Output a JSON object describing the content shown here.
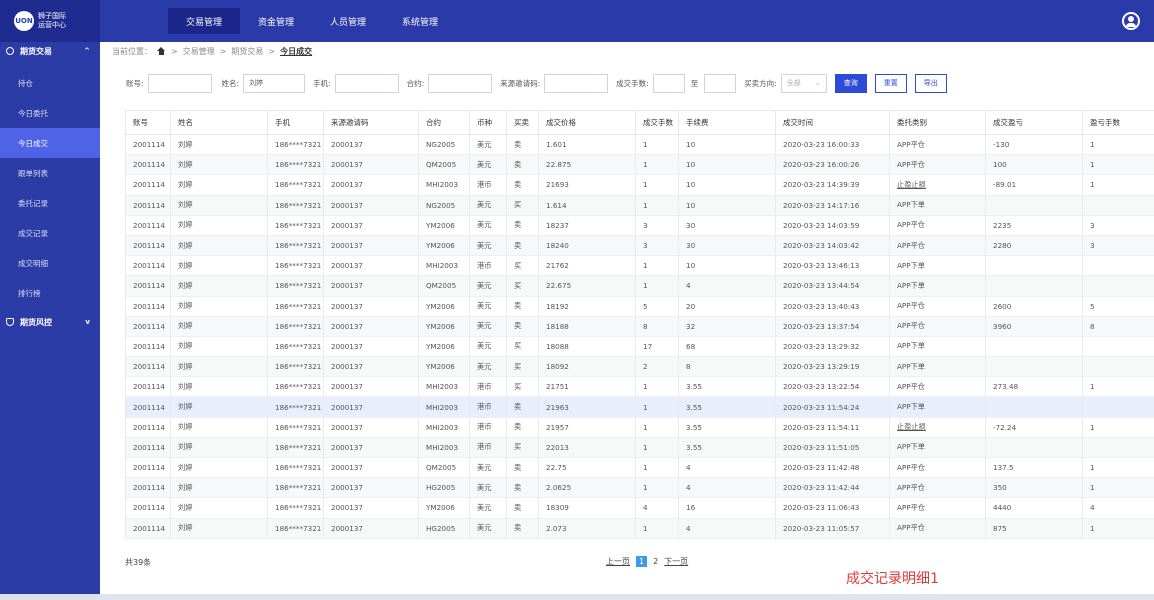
{
  "logo": {
    "mark": "UON",
    "line1": "狮子国际",
    "line2": "运营中心"
  },
  "top_nav": [
    {
      "label": "交易管理",
      "active": true
    },
    {
      "label": "资金管理",
      "active": false
    },
    {
      "label": "人员管理",
      "active": false
    },
    {
      "label": "系统管理",
      "active": false
    }
  ],
  "sidebar": {
    "group1": {
      "label": "期货交易",
      "chevron": "^"
    },
    "items": [
      {
        "label": "持仓",
        "active": false
      },
      {
        "label": "今日委托",
        "active": false
      },
      {
        "label": "今日成交",
        "active": true
      },
      {
        "label": "跟单列表",
        "active": false
      },
      {
        "label": "委托记录",
        "active": false
      },
      {
        "label": "成交记录",
        "active": false
      },
      {
        "label": "成交明细",
        "active": false
      },
      {
        "label": "排行榜",
        "active": false
      }
    ],
    "group2": {
      "label": "期货风控",
      "chevron": "v"
    }
  },
  "breadcrumb": {
    "prefix": "当前位置：",
    "items": [
      "交易管理",
      "期货交易"
    ],
    "current": "今日成交",
    "sep": ">"
  },
  "filters": {
    "account_label": "账号:",
    "name_label": "姓名:",
    "name_value": "刘婷",
    "phone_label": "手机:",
    "contract_label": "合约:",
    "invite_label": "来源邀请码:",
    "lots_label": "成交手数:",
    "to_label": "至",
    "direction_label": "买卖方向:",
    "direction_value": "全部",
    "query_button": "查询",
    "reset_button": "重置",
    "export_button": "导出"
  },
  "table": {
    "columns": [
      "账号",
      "姓名",
      "手机",
      "来源邀请码",
      "合约",
      "币种",
      "买卖",
      "成交价格",
      "成交手数",
      "手续费",
      "成交时间",
      "委托类别",
      "成交盈亏",
      "盈亏手数"
    ],
    "rows": [
      [
        "2001114",
        "刘婷",
        "186****7321",
        "2000137",
        "NG2005",
        "美元",
        "卖",
        "1.601",
        "1",
        "10",
        "2020-03-23 16:00:33",
        "APP平仓",
        "-130",
        "1"
      ],
      [
        "2001114",
        "刘婷",
        "186****7321",
        "2000137",
        "QM2005",
        "美元",
        "卖",
        "22.875",
        "1",
        "10",
        "2020-03-23 16:00:26",
        "APP平仓",
        "100",
        "1"
      ],
      [
        "2001114",
        "刘婷",
        "186****7321",
        "2000137",
        "MHI2003",
        "港币",
        "卖",
        "21693",
        "1",
        "10",
        "2020-03-23 14:39:39",
        "止盈止损",
        "-89.01",
        "1"
      ],
      [
        "2001114",
        "刘婷",
        "186****7321",
        "2000137",
        "NG2005",
        "美元",
        "买",
        "1.614",
        "1",
        "10",
        "2020-03-23 14:17:16",
        "APP下单",
        "",
        ""
      ],
      [
        "2001114",
        "刘婷",
        "186****7321",
        "2000137",
        "YM2006",
        "美元",
        "卖",
        "18237",
        "3",
        "30",
        "2020-03-23 14:03:59",
        "APP平仓",
        "2235",
        "3"
      ],
      [
        "2001114",
        "刘婷",
        "186****7321",
        "2000137",
        "YM2006",
        "美元",
        "卖",
        "18240",
        "3",
        "30",
        "2020-03-23 14:03:42",
        "APP平仓",
        "2280",
        "3"
      ],
      [
        "2001114",
        "刘婷",
        "186****7321",
        "2000137",
        "MHI2003",
        "港币",
        "买",
        "21762",
        "1",
        "10",
        "2020-03-23 13:46:13",
        "APP下单",
        "",
        ""
      ],
      [
        "2001114",
        "刘婷",
        "186****7321",
        "2000137",
        "QM2005",
        "美元",
        "买",
        "22.675",
        "1",
        "4",
        "2020-03-23 13:44:54",
        "APP下单",
        "",
        ""
      ],
      [
        "2001114",
        "刘婷",
        "186****7321",
        "2000137",
        "YM2006",
        "美元",
        "卖",
        "18192",
        "5",
        "20",
        "2020-03-23 13:40:43",
        "APP平仓",
        "2600",
        "5"
      ],
      [
        "2001114",
        "刘婷",
        "186****7321",
        "2000137",
        "YM2006",
        "美元",
        "卖",
        "18188",
        "8",
        "32",
        "2020-03-23 13:37:54",
        "APP平仓",
        "3960",
        "8"
      ],
      [
        "2001114",
        "刘婷",
        "186****7321",
        "2000137",
        "YM2006",
        "美元",
        "买",
        "18088",
        "17",
        "68",
        "2020-03-23 13:29:32",
        "APP下单",
        "",
        ""
      ],
      [
        "2001114",
        "刘婷",
        "186****7321",
        "2000137",
        "YM2006",
        "美元",
        "买",
        "18092",
        "2",
        "8",
        "2020-03-23 13:29:19",
        "APP下单",
        "",
        ""
      ],
      [
        "2001114",
        "刘婷",
        "186****7321",
        "2000137",
        "MHI2003",
        "港币",
        "买",
        "21751",
        "1",
        "3.55",
        "2020-03-23 13:22:54",
        "APP平仓",
        "273.48",
        "1"
      ],
      [
        "2001114",
        "刘婷",
        "186****7321",
        "2000137",
        "MHI2003",
        "港币",
        "卖",
        "21963",
        "1",
        "3.55",
        "2020-03-23 11:54:24",
        "APP下单",
        "",
        ""
      ],
      [
        "2001114",
        "刘婷",
        "186****7321",
        "2000137",
        "MHI2003",
        "港币",
        "卖",
        "21957",
        "1",
        "3.55",
        "2020-03-23 11:54:11",
        "止盈止损",
        "-72.24",
        "1"
      ],
      [
        "2001114",
        "刘婷",
        "186****7321",
        "2000137",
        "MHI2003",
        "港币",
        "买",
        "22013",
        "1",
        "3.55",
        "2020-03-23 11:51:05",
        "APP下单",
        "",
        ""
      ],
      [
        "2001114",
        "刘婷",
        "186****7321",
        "2000137",
        "QM2005",
        "美元",
        "卖",
        "22.75",
        "1",
        "4",
        "2020-03-23 11:42:48",
        "APP平仓",
        "137.5",
        "1"
      ],
      [
        "2001114",
        "刘婷",
        "186****7321",
        "2000137",
        "HG2005",
        "美元",
        "卖",
        "2.0625",
        "1",
        "4",
        "2020-03-23 11:42:44",
        "APP平仓",
        "350",
        "1"
      ],
      [
        "2001114",
        "刘婷",
        "186****7321",
        "2000137",
        "YM2006",
        "美元",
        "卖",
        "18309",
        "4",
        "16",
        "2020-03-23 11:06:43",
        "APP平仓",
        "4440",
        "4"
      ],
      [
        "2001114",
        "刘婷",
        "186****7321",
        "2000137",
        "HG2005",
        "美元",
        "卖",
        "2.073",
        "1",
        "4",
        "2020-03-23 11:05:57",
        "APP平仓",
        "875",
        "1"
      ]
    ]
  },
  "footer": {
    "total": "共39条",
    "prev": "上一页",
    "pages": [
      "1",
      "2"
    ],
    "current_page": "1",
    "next": "下一页"
  },
  "annotation": "成交记录明细1"
}
